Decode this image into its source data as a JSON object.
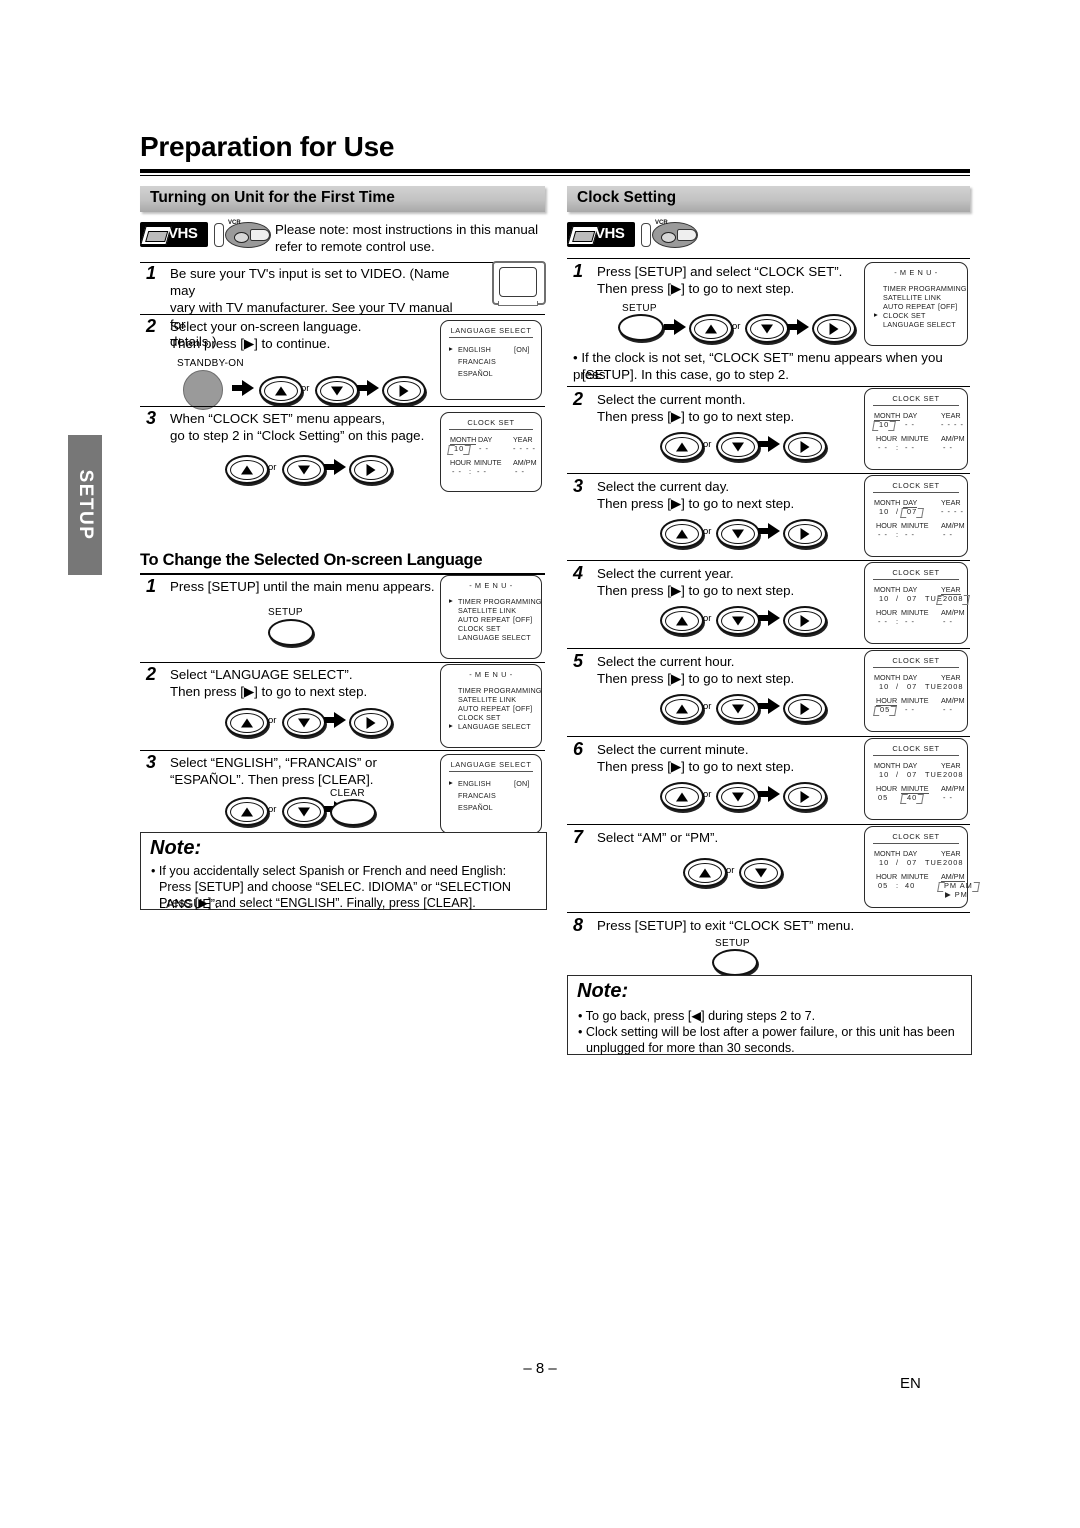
{
  "page": {
    "title": "Preparation for Use",
    "side_tab": "SETUP",
    "page_number": "– 8 –",
    "language_code": "EN"
  },
  "left": {
    "section_title": "Turning on Unit for the First Time",
    "media_icons": {
      "vhs": "VHS",
      "vcr": "VCR"
    },
    "intro": "Please note: most instructions in this manual refer to remote control use.",
    "steps": [
      {
        "num": "1",
        "line1": "Be sure your TV's input is set to VIDEO. (Name may",
        "line2": "vary with TV manufacturer. See your TV manual for",
        "line3": "details.)"
      },
      {
        "num": "2",
        "line1": "Select your on-screen language.",
        "line2": "Then press [▶] to continue.",
        "key": "STANDBY-ON",
        "or": "or"
      },
      {
        "num": "3",
        "line1": "When “CLOCK SET” menu appears,",
        "line2": "go to step 2 in “Clock Setting” on this page.",
        "or": "or"
      }
    ],
    "osd_language_select": {
      "title": "LANGUAGE SELECT",
      "items": [
        "ENGLISH",
        "FRANCAIS",
        "ESPAÑOL"
      ],
      "value": "[ON]",
      "cursor_index": 0
    },
    "osd_clock_set": {
      "title": "CLOCK SET",
      "labels": {
        "month": "MONTH",
        "day": "DAY",
        "year": "YEAR",
        "hour": "HOUR",
        "minute": "MINUTE",
        "ampm": "AM/PM"
      },
      "values": {
        "month": "10",
        "day": "- -",
        "year": "- - - -",
        "hour": "- -",
        "sep": ":",
        "minute": "- -",
        "ampm": "- -"
      }
    },
    "subsection_title": "To Change the Selected On-screen Language",
    "lang_steps": [
      {
        "num": "1",
        "line1": "Press [SETUP] until the main menu appears.",
        "key": "SETUP"
      },
      {
        "num": "2",
        "line1": "Select “LANGUAGE SELECT”.",
        "line2": "Then press [▶] to go to next step.",
        "or": "or"
      },
      {
        "num": "3",
        "line1": "Select “ENGLISH”, “FRANCAIS” or",
        "line2": "“ESPAÑOL”. Then press [CLEAR].",
        "or": "or",
        "key": "CLEAR"
      }
    ],
    "osd_menu": {
      "title": "- M E N U -",
      "items": [
        "TIMER PROGRAMMING",
        "SATELLITE LINK",
        "AUTO REPEAT",
        "CLOCK SET",
        "LANGUAGE SELECT"
      ],
      "auto_repeat_value": "[OFF]"
    },
    "note": {
      "heading": "Note:",
      "lines": [
        "• If you accidentally select Spanish or French and need English:",
        "Press [SETUP] and choose “SELEC. IDIOMA” or “SELECTION LANGUE”.",
        "Press [▶] and select “ENGLISH”. Finally, press [CLEAR]."
      ]
    }
  },
  "right": {
    "section_title": "Clock Setting",
    "media_icons": {
      "vhs": "VHS",
      "vcr": "VCR"
    },
    "steps": [
      {
        "num": "1",
        "line1": "Press [SETUP] and select “CLOCK SET”.",
        "line2": "Then press [▶] to go to next step.",
        "key": "SETUP",
        "or": "or"
      },
      {
        "num": "2",
        "line1": "Select the current month.",
        "line2": "Then press [▶] to go to next step.",
        "or": "or"
      },
      {
        "num": "3",
        "line1": "Select the current day.",
        "line2": "Then press [▶] to go to next step.",
        "or": "or"
      },
      {
        "num": "4",
        "line1": "Select the current year.",
        "line2": "Then press [▶] to go to next step.",
        "or": "or"
      },
      {
        "num": "5",
        "line1": "Select the current hour.",
        "line2": "Then press [▶] to go to next step.",
        "or": "or"
      },
      {
        "num": "6",
        "line1": "Select the current minute.",
        "line2": "Then press [▶] to go to next step.",
        "or": "or"
      },
      {
        "num": "7",
        "line1": "Select “AM” or “PM”.",
        "line2": "",
        "or": "or"
      },
      {
        "num": "8",
        "line1": "Press [SETUP] to exit “CLOCK SET” menu.",
        "key": "SETUP"
      }
    ],
    "bullet": {
      "line1": "• If the clock is not set, “CLOCK SET” menu appears when you press",
      "line2": "[SETUP]. In this case, go to step 2."
    },
    "osd_menu": {
      "title": "- M E N U -",
      "items": [
        "TIMER PROGRAMMING",
        "SATELLITE LINK",
        "AUTO REPEAT",
        "CLOCK SET",
        "LANGUAGE SELECT"
      ],
      "auto_repeat_value": "[OFF]",
      "cursor_item": "CLOCK SET"
    },
    "osd_clock": {
      "title": "CLOCK SET",
      "labels": {
        "month": "MONTH",
        "day": "DAY",
        "year": "YEAR",
        "hour": "HOUR",
        "minute": "MINUTE",
        "ampm": "AM/PM"
      },
      "states": [
        {
          "month": "10",
          "day": "- -",
          "year": "- - - -",
          "weekday": "",
          "hour": "- -",
          "minute": "- -",
          "ampm": "- -",
          "blink": "month"
        },
        {
          "month": "10",
          "day": "07",
          "year": "- - - -",
          "weekday": "",
          "hour": "- -",
          "minute": "- -",
          "ampm": "- -",
          "blink": "day"
        },
        {
          "month": "10",
          "day": "07",
          "year": "2008",
          "weekday": "TUE",
          "hour": "- -",
          "minute": "- -",
          "ampm": "- -",
          "blink": "year"
        },
        {
          "month": "10",
          "day": "07",
          "year": "2008",
          "weekday": "TUE",
          "hour": "05",
          "minute": "- -",
          "ampm": "- -",
          "blink": "hour"
        },
        {
          "month": "10",
          "day": "07",
          "year": "2008",
          "weekday": "TUE",
          "hour": "05",
          "minute": "40",
          "ampm": "- -",
          "blink": "minute"
        },
        {
          "month": "10",
          "day": "07",
          "year": "2008",
          "weekday": "TUE",
          "hour": "05",
          "minute": "40",
          "ampm": "PM AM",
          "ampm2": "▶ PM",
          "blink": "ampm"
        }
      ],
      "sep_date": "/",
      "sep_time": ":"
    },
    "note": {
      "heading": "Note:",
      "lines": [
        "• To go back, press [◀] during steps 2 to 7.",
        "• Clock setting will be lost after a power failure, or this unit has been",
        "unplugged for more than 30 seconds."
      ]
    }
  }
}
